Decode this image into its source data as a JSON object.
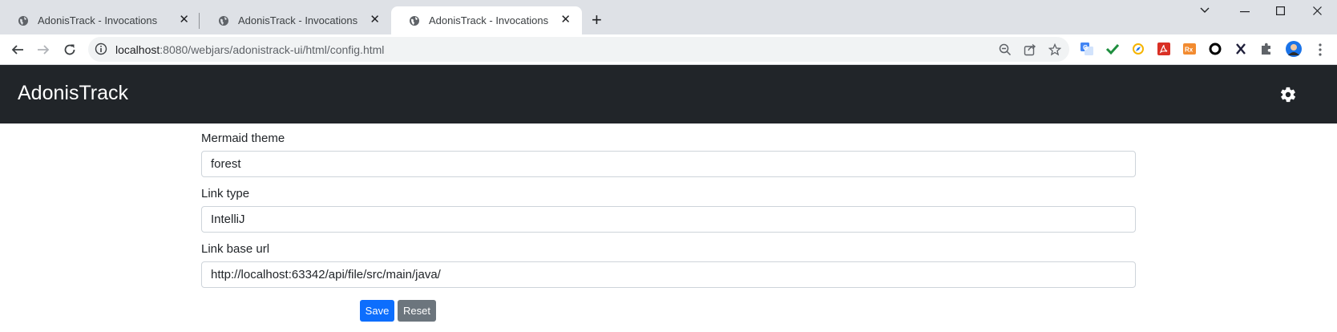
{
  "browser": {
    "tabs": [
      {
        "title": "AdonisTrack - Invocations",
        "active": false
      },
      {
        "title": "AdonisTrack - Invocations",
        "active": false
      },
      {
        "title": "AdonisTrack - Invocations",
        "active": true
      }
    ],
    "url": {
      "host": "localhost",
      "rest": ":8080/webjars/adonistrack-ui/html/config.html"
    },
    "extensions": [
      "translate-icon",
      "check-icon",
      "compass-icon",
      "pdf-icon",
      "rx-icon",
      "circle-icon",
      "x-icon",
      "puzzle-icon",
      "avatar"
    ]
  },
  "app": {
    "brand": "AdonisTrack",
    "settings_icon": "gear-icon"
  },
  "form": {
    "mermaid_theme": {
      "label": "Mermaid theme",
      "value": "forest"
    },
    "link_type": {
      "label": "Link type",
      "value": "IntelliJ"
    },
    "link_base_url": {
      "label": "Link base url",
      "value": "http://localhost:63342/api/file/src/main/java/"
    },
    "save_label": "Save",
    "reset_label": "Reset"
  },
  "colors": {
    "navbar": "#212529",
    "primary": "#0d6efd",
    "secondary": "#6c757d"
  }
}
